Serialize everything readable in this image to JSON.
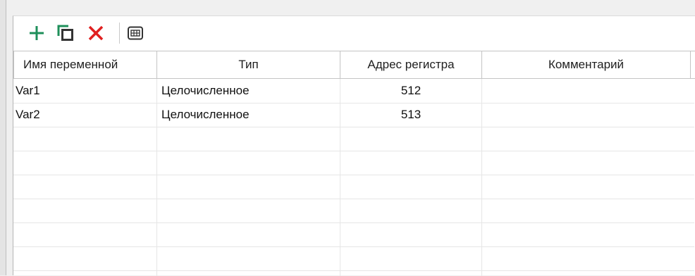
{
  "toolbar": {
    "add": {
      "icon": "plus-icon",
      "color": "#1e8f5a"
    },
    "copy": {
      "icon": "copy-icon",
      "color": "#1e8f5a"
    },
    "delete": {
      "icon": "delete-x-icon",
      "color": "#e02020"
    },
    "table": {
      "icon": "table-grid-icon"
    }
  },
  "table": {
    "columns": [
      "Имя переменной",
      "Тип",
      "Адрес регистра",
      "Комментарий"
    ],
    "rows": [
      {
        "name": "Var1",
        "type": "Целочисленное",
        "address": "512",
        "comment": ""
      },
      {
        "name": "Var2",
        "type": "Целочисленное",
        "address": "513",
        "comment": ""
      }
    ]
  }
}
